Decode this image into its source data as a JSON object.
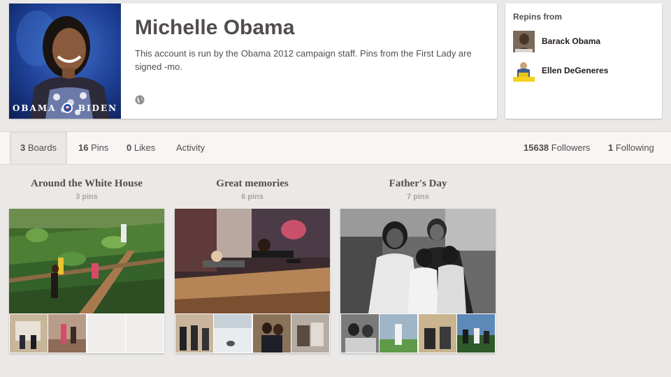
{
  "profile": {
    "name": "Michelle Obama",
    "bio": "This account is run by the Obama 2012 campaign staff. Pins from the First Lady are signed -mo.",
    "avatar_caption_left": "OBAMA",
    "avatar_caption_right": "BIDEN",
    "website_icon": "globe-icon"
  },
  "repins": {
    "title": "Repins from",
    "users": [
      {
        "name": "Barack Obama"
      },
      {
        "name": "Ellen DeGeneres"
      }
    ]
  },
  "tabs": [
    {
      "count": "3",
      "label": "Boards"
    },
    {
      "count": "16",
      "label": "Pins"
    },
    {
      "count": "0",
      "label": "Likes"
    },
    {
      "count": "",
      "label": "Activity"
    }
  ],
  "follow": {
    "followers_count": "15638",
    "followers_label": "Followers",
    "following_count": "1",
    "following_label": "Following"
  },
  "boards": [
    {
      "title": "Around the White House",
      "count": "3 pins"
    },
    {
      "title": "Great memories",
      "count": "6 pins"
    },
    {
      "title": "Father's Day",
      "count": "7 pins"
    }
  ],
  "colors": {
    "background": "#ebe9e7",
    "text": "#524d4d",
    "muted": "#a7a4a4",
    "card": "#ffffff"
  }
}
